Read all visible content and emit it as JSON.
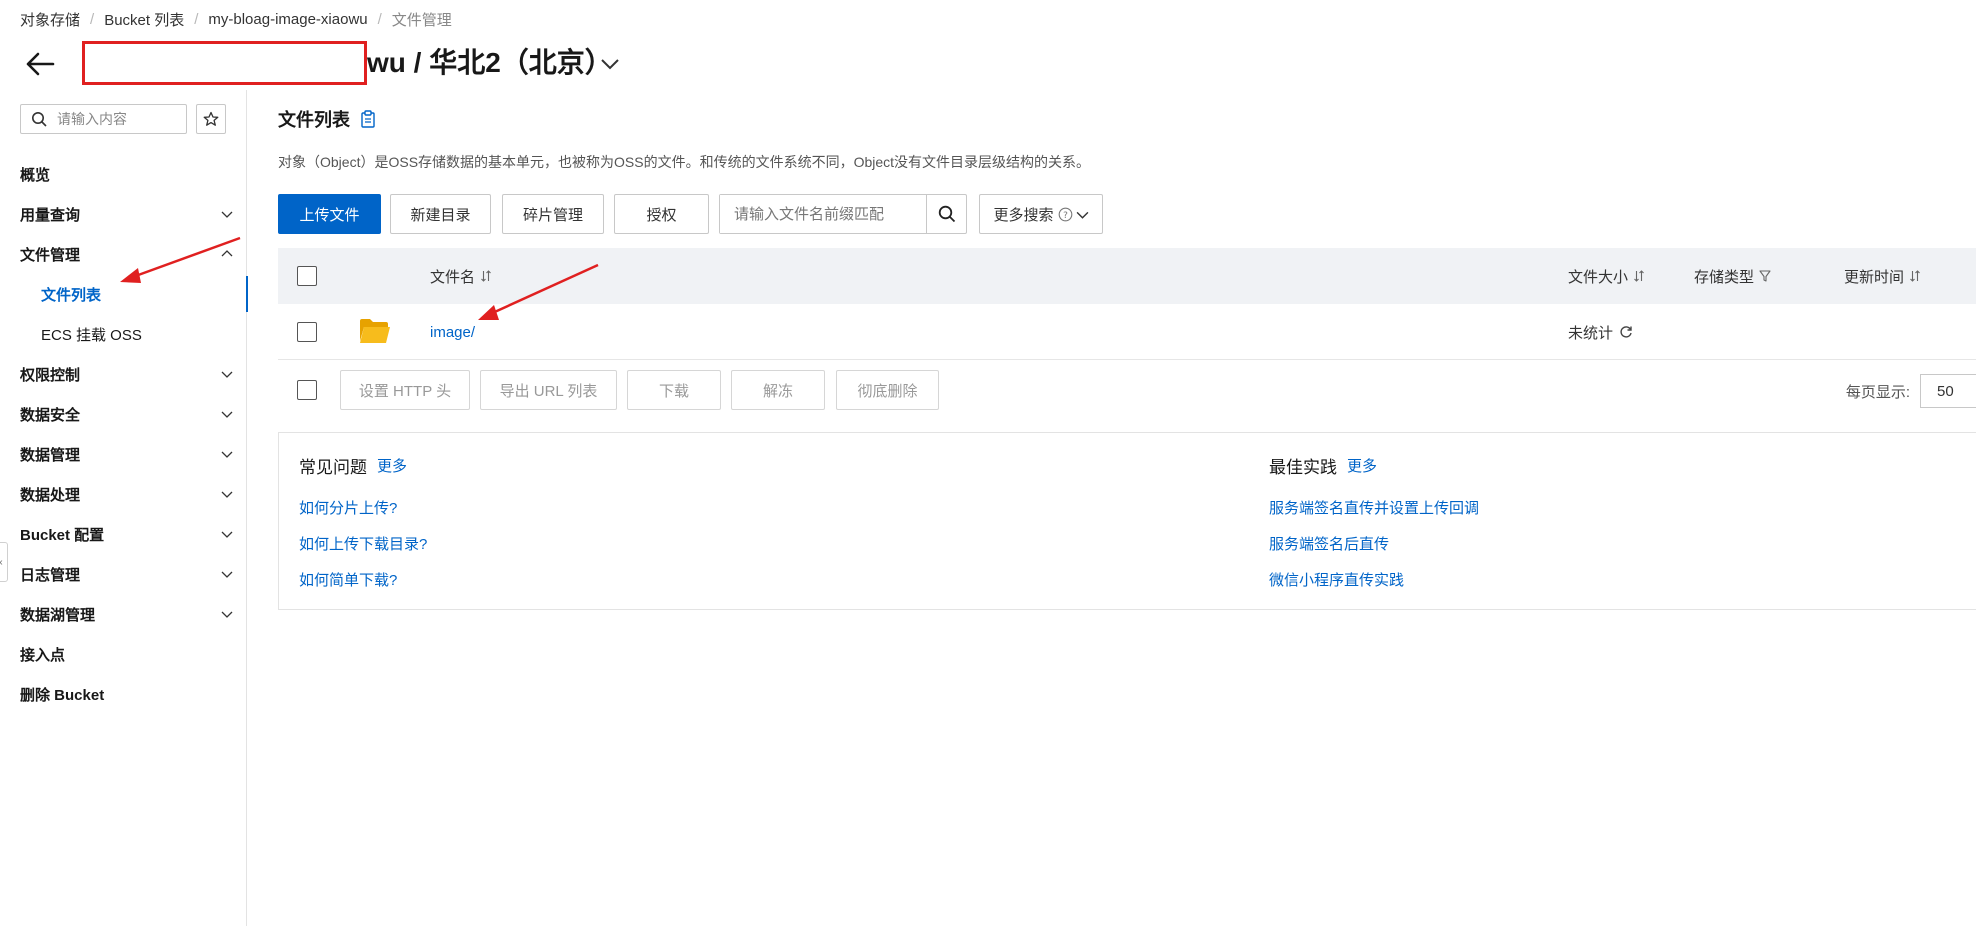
{
  "breadcrumb": [
    "对象存储",
    "Bucket 列表",
    "my-bloag-image-xiaowu",
    "文件管理"
  ],
  "header": {
    "bucket_title": "wu / 华北2（北京）"
  },
  "sidebar": {
    "search_placeholder": "请输入内容",
    "items": [
      {
        "label": "概览",
        "expandable": false
      },
      {
        "label": "用量查询",
        "expandable": true
      },
      {
        "label": "文件管理",
        "expandable": true,
        "expanded": true
      },
      {
        "label": "文件列表",
        "sub": true,
        "active": true
      },
      {
        "label": "ECS 挂载 OSS",
        "sub": true
      },
      {
        "label": "权限控制",
        "expandable": true
      },
      {
        "label": "数据安全",
        "expandable": true
      },
      {
        "label": "数据管理",
        "expandable": true
      },
      {
        "label": "数据处理",
        "expandable": true
      },
      {
        "label": "Bucket 配置",
        "expandable": true
      },
      {
        "label": "日志管理",
        "expandable": true
      },
      {
        "label": "数据湖管理",
        "expandable": true
      },
      {
        "label": "接入点",
        "expandable": false
      },
      {
        "label": "删除 Bucket",
        "expandable": false
      }
    ]
  },
  "main": {
    "title": "文件列表",
    "description": "对象（Object）是OSS存储数据的基本单元，也被称为OSS的文件。和传统的文件系统不同，Object没有文件目录层级结构的关系。",
    "toolbar": {
      "upload": "上传文件",
      "new_dir": "新建目录",
      "fragments": "碎片管理",
      "authorize": "授权",
      "search_placeholder": "请输入文件名前缀匹配",
      "more_search": "更多搜索"
    },
    "table": {
      "columns": {
        "name": "文件名",
        "size": "文件大小",
        "storage": "存储类型",
        "updated": "更新时间"
      },
      "rows": [
        {
          "name": "image/",
          "size": "未统计"
        }
      ]
    },
    "bulk_actions": [
      "设置 HTTP 头",
      "导出 URL 列表",
      "下载",
      "解冻",
      "彻底删除"
    ],
    "pagination": {
      "per_page_label": "每页显示:",
      "per_page_value": "50"
    },
    "faq": {
      "title": "常见问题",
      "more": "更多",
      "links": [
        "如何分片上传?",
        "如何上传下载目录?",
        "如何简单下载?"
      ]
    },
    "best_practice": {
      "title": "最佳实践",
      "more": "更多",
      "links": [
        "服务端签名直传并设置上传回调",
        "服务端签名后直传",
        "微信小程序直传实践"
      ]
    }
  },
  "colors": {
    "primary": "#0064c8",
    "annotation_red": "#e02020",
    "table_header_bg": "#f0f2f5",
    "folder": "#f5b400"
  }
}
